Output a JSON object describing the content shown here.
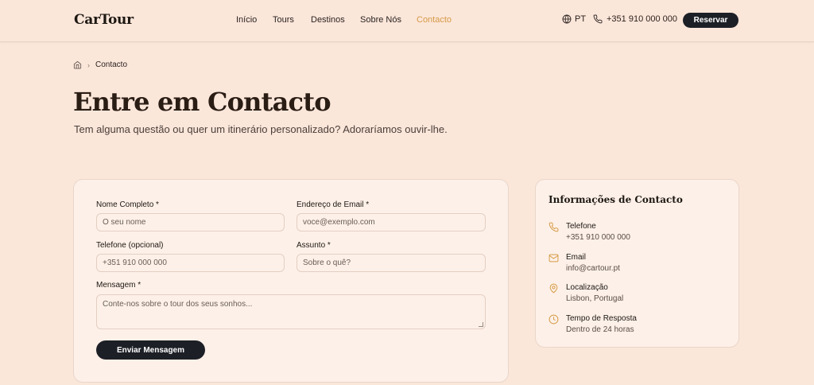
{
  "brand": "CarTour",
  "nav": [
    "Início",
    "Tours",
    "Destinos",
    "Sobre Nós",
    "Contacto"
  ],
  "nav_active": "Contacto",
  "header": {
    "language": "PT",
    "phone": "+351 910 000 000",
    "reserve_label": "Reservar"
  },
  "breadcrumb": {
    "current": "Contacto"
  },
  "page": {
    "title": "Entre em Contacto",
    "subtitle": "Tem alguma questão ou quer um itinerário personalizado? Adoraríamos ouvir-lhe."
  },
  "form": {
    "name_label": "Nome Completo *",
    "name_placeholder": "O seu nome",
    "email_label": "Endereço de Email *",
    "email_placeholder": "voce@exemplo.com",
    "phone_label": "Telefone (opcional)",
    "phone_placeholder": "+351 910 000 000",
    "subject_label": "Assunto *",
    "subject_placeholder": "Sobre o quê?",
    "message_label": "Mensagem *",
    "message_placeholder": "Conte-nos sobre o tour dos seus sonhos...",
    "submit_label": "Enviar Mensagem"
  },
  "contact_info": {
    "title": "Informações de Contacto",
    "items": [
      {
        "icon": "phone-icon",
        "label": "Telefone",
        "value": "+351 910 000 000"
      },
      {
        "icon": "mail-icon",
        "label": "Email",
        "value": "info@cartour.pt"
      },
      {
        "icon": "location-pin-icon",
        "label": "Localização",
        "value": "Lisbon, Portugal"
      },
      {
        "icon": "clock-icon",
        "label": "Tempo de Resposta",
        "value": "Dentro de 24 horas"
      }
    ]
  },
  "colors": {
    "background": "#fbe6da",
    "accent": "#d59b45",
    "dark": "#1c1f26"
  }
}
